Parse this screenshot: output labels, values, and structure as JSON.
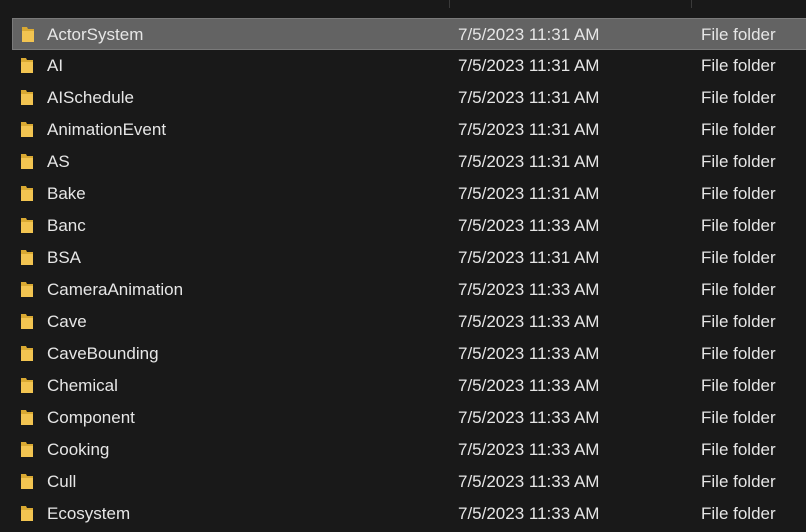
{
  "icons": {
    "folder": "folder-icon",
    "folder_color": "#f2c451",
    "folder_shade": "#d9a933"
  },
  "files": [
    {
      "name": "ActorSystem",
      "date": "7/5/2023 11:31 AM",
      "type": "File folder",
      "selected": true
    },
    {
      "name": "AI",
      "date": "7/5/2023 11:31 AM",
      "type": "File folder"
    },
    {
      "name": "AISchedule",
      "date": "7/5/2023 11:31 AM",
      "type": "File folder"
    },
    {
      "name": "AnimationEvent",
      "date": "7/5/2023 11:31 AM",
      "type": "File folder"
    },
    {
      "name": "AS",
      "date": "7/5/2023 11:31 AM",
      "type": "File folder"
    },
    {
      "name": "Bake",
      "date": "7/5/2023 11:31 AM",
      "type": "File folder"
    },
    {
      "name": "Banc",
      "date": "7/5/2023 11:33 AM",
      "type": "File folder"
    },
    {
      "name": "BSA",
      "date": "7/5/2023 11:31 AM",
      "type": "File folder"
    },
    {
      "name": "CameraAnimation",
      "date": "7/5/2023 11:33 AM",
      "type": "File folder"
    },
    {
      "name": "Cave",
      "date": "7/5/2023 11:33 AM",
      "type": "File folder"
    },
    {
      "name": "CaveBounding",
      "date": "7/5/2023 11:33 AM",
      "type": "File folder"
    },
    {
      "name": "Chemical",
      "date": "7/5/2023 11:33 AM",
      "type": "File folder"
    },
    {
      "name": "Component",
      "date": "7/5/2023 11:33 AM",
      "type": "File folder"
    },
    {
      "name": "Cooking",
      "date": "7/5/2023 11:33 AM",
      "type": "File folder"
    },
    {
      "name": "Cull",
      "date": "7/5/2023 11:33 AM",
      "type": "File folder"
    },
    {
      "name": "Ecosystem",
      "date": "7/5/2023 11:33 AM",
      "type": "File folder"
    }
  ]
}
